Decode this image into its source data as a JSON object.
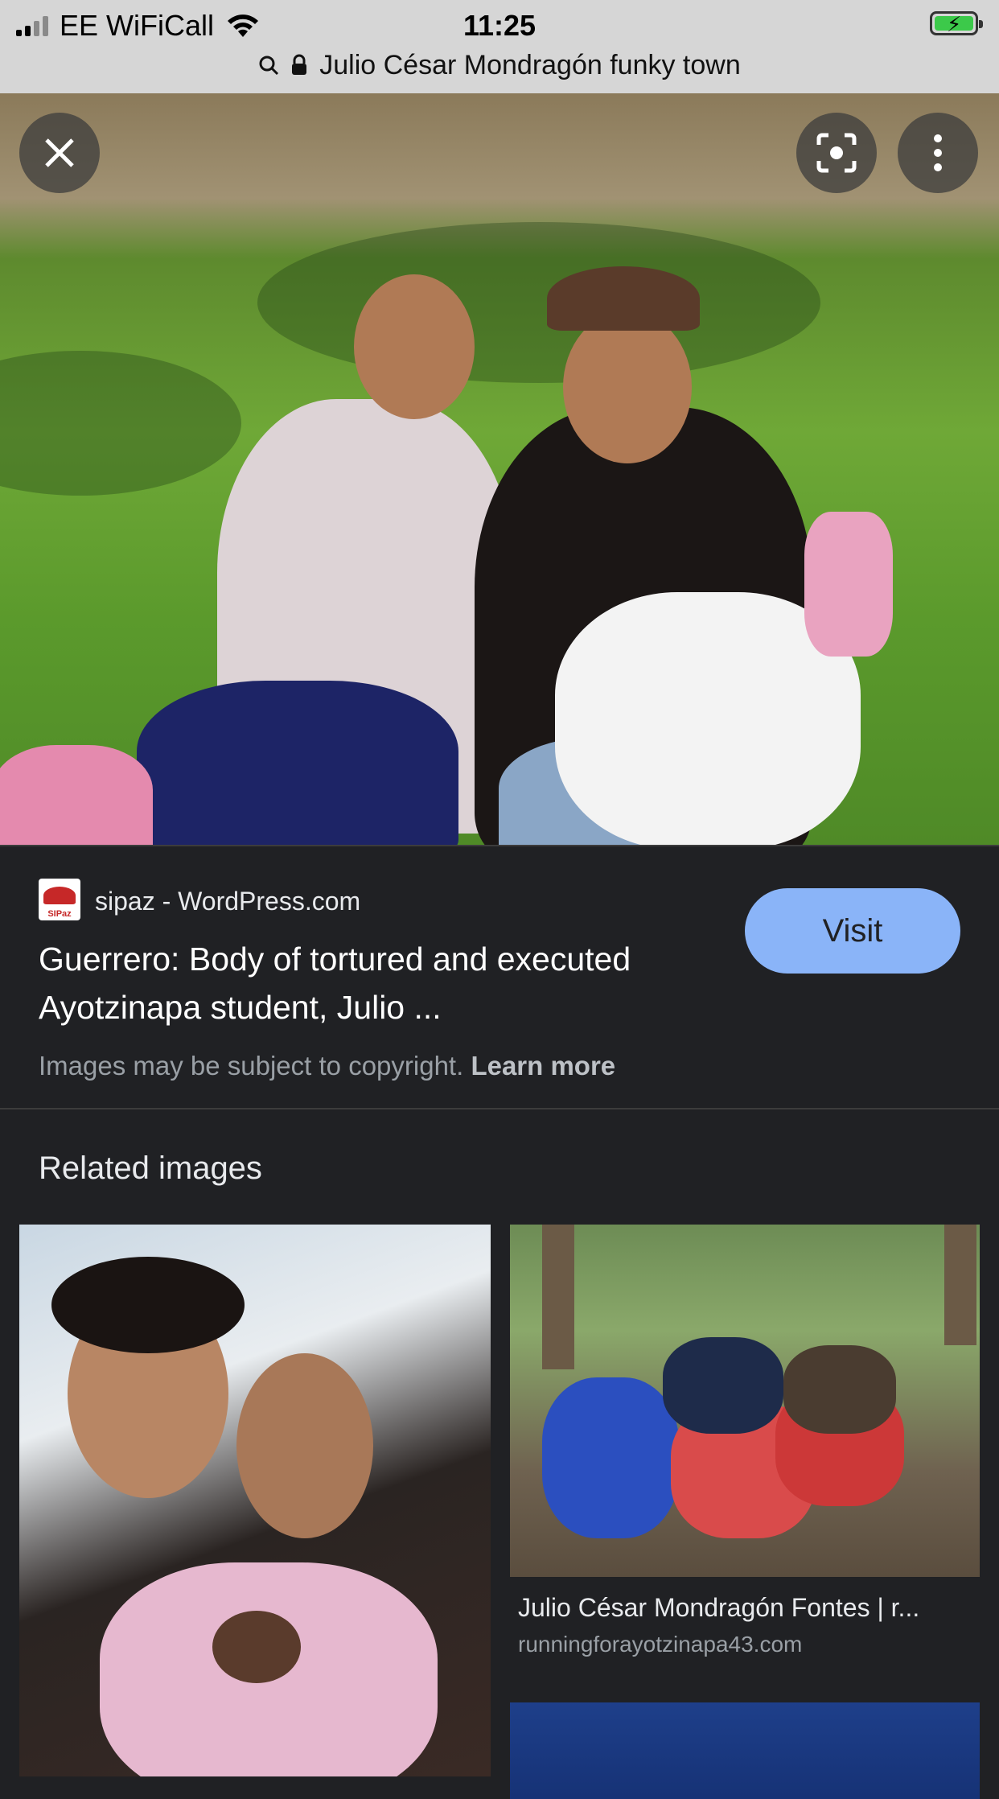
{
  "status_bar": {
    "carrier": "EE WiFiCall",
    "time": "11:25"
  },
  "url_bar": {
    "query": "Julio César Mondragón funky town"
  },
  "hero": {
    "close_icon": "close-icon",
    "lens_icon": "lens-icon",
    "more_icon": "more-vert-icon"
  },
  "result": {
    "favicon_text": "SIPaz",
    "source": "sipaz - WordPress.com",
    "title_line1": "Guerrero: Body of tortured and executed",
    "title_line2": "Ayotzinapa student, Julio ...",
    "visit_label": "Visit",
    "copyright_text": "Images may be subject to copyright.",
    "learn_more": "Learn more"
  },
  "related": {
    "heading": "Related images",
    "items": [
      {
        "title": "",
        "domain": ""
      },
      {
        "title": "Julio César Mondragón Fontes | r...",
        "domain": "runningforayotzinapa43.com"
      },
      {
        "title": "",
        "domain": ""
      }
    ]
  },
  "colors": {
    "background": "#202124",
    "visit_button": "#8ab4f8",
    "status_bar": "#d6d6d6"
  }
}
